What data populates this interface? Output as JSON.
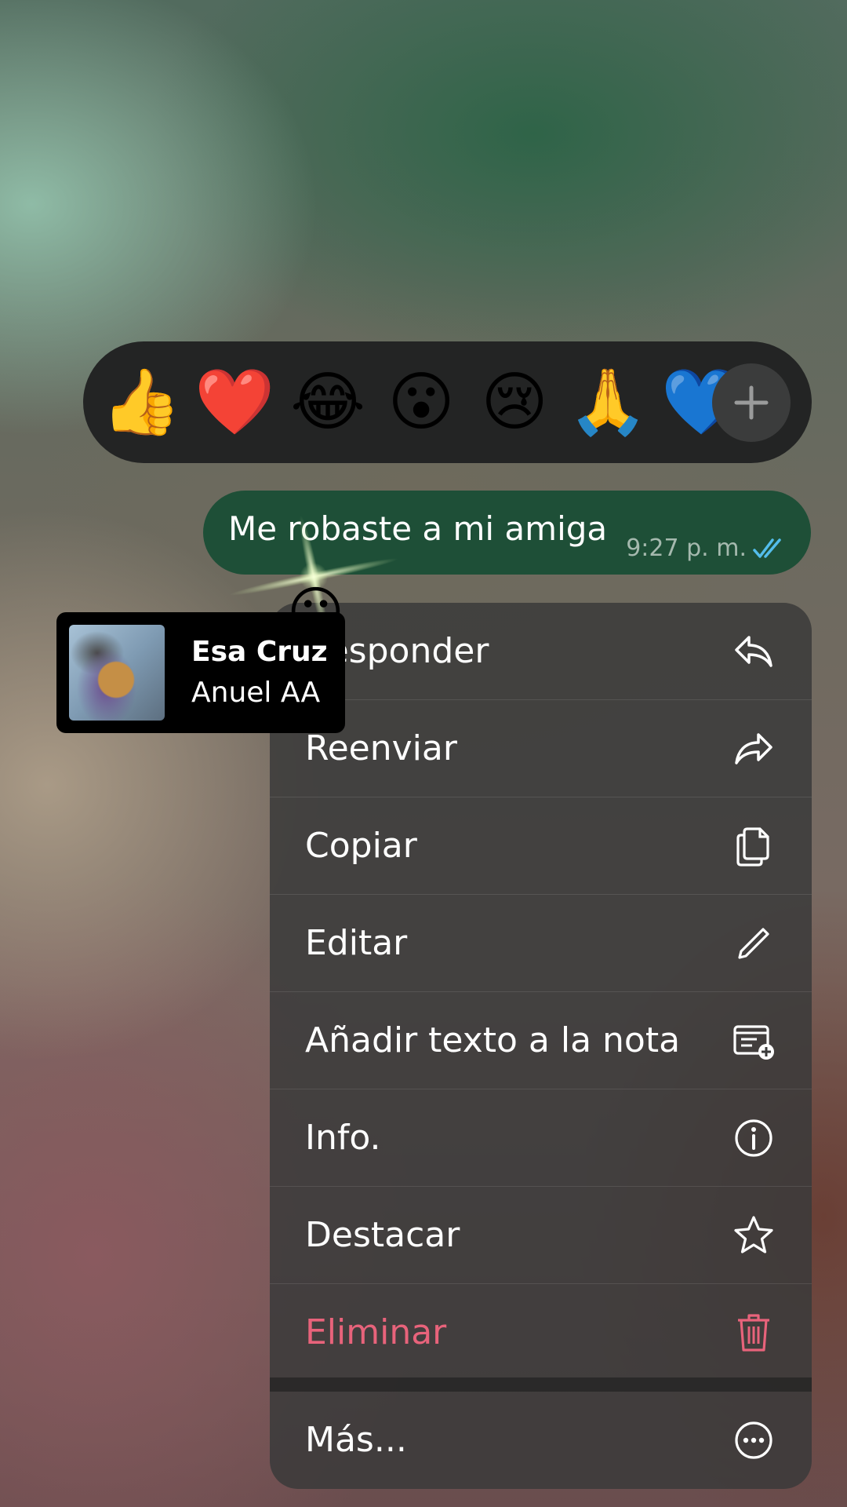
{
  "reactions": {
    "emojis": [
      "👍",
      "❤️",
      "😂",
      "😮",
      "😢",
      "🙏",
      "💙"
    ],
    "more_icon": "plus-icon"
  },
  "message": {
    "text": "Me robaste a mi amiga",
    "time": "9:27 p. m.",
    "status_icon": "double-check-icon",
    "status_color": "#53bdeb"
  },
  "music_overlay": {
    "title": "Esa Cruz",
    "artist": "Anuel AA",
    "floating_emoji": "😕"
  },
  "menu": {
    "items": [
      {
        "label": "Responder",
        "icon": "reply-icon"
      },
      {
        "label": "Reenviar",
        "icon": "forward-icon"
      },
      {
        "label": "Copiar",
        "icon": "copy-icon"
      },
      {
        "label": "Editar",
        "icon": "pencil-icon"
      },
      {
        "label": "Añadir texto a la nota",
        "icon": "note-add-icon"
      },
      {
        "label": "Info.",
        "icon": "info-icon"
      },
      {
        "label": "Destacar",
        "icon": "star-icon"
      },
      {
        "label": "Eliminar",
        "icon": "trash-icon"
      }
    ],
    "more": {
      "label": "Más...",
      "icon": "more-icon"
    },
    "danger_color": "#e8637b"
  }
}
